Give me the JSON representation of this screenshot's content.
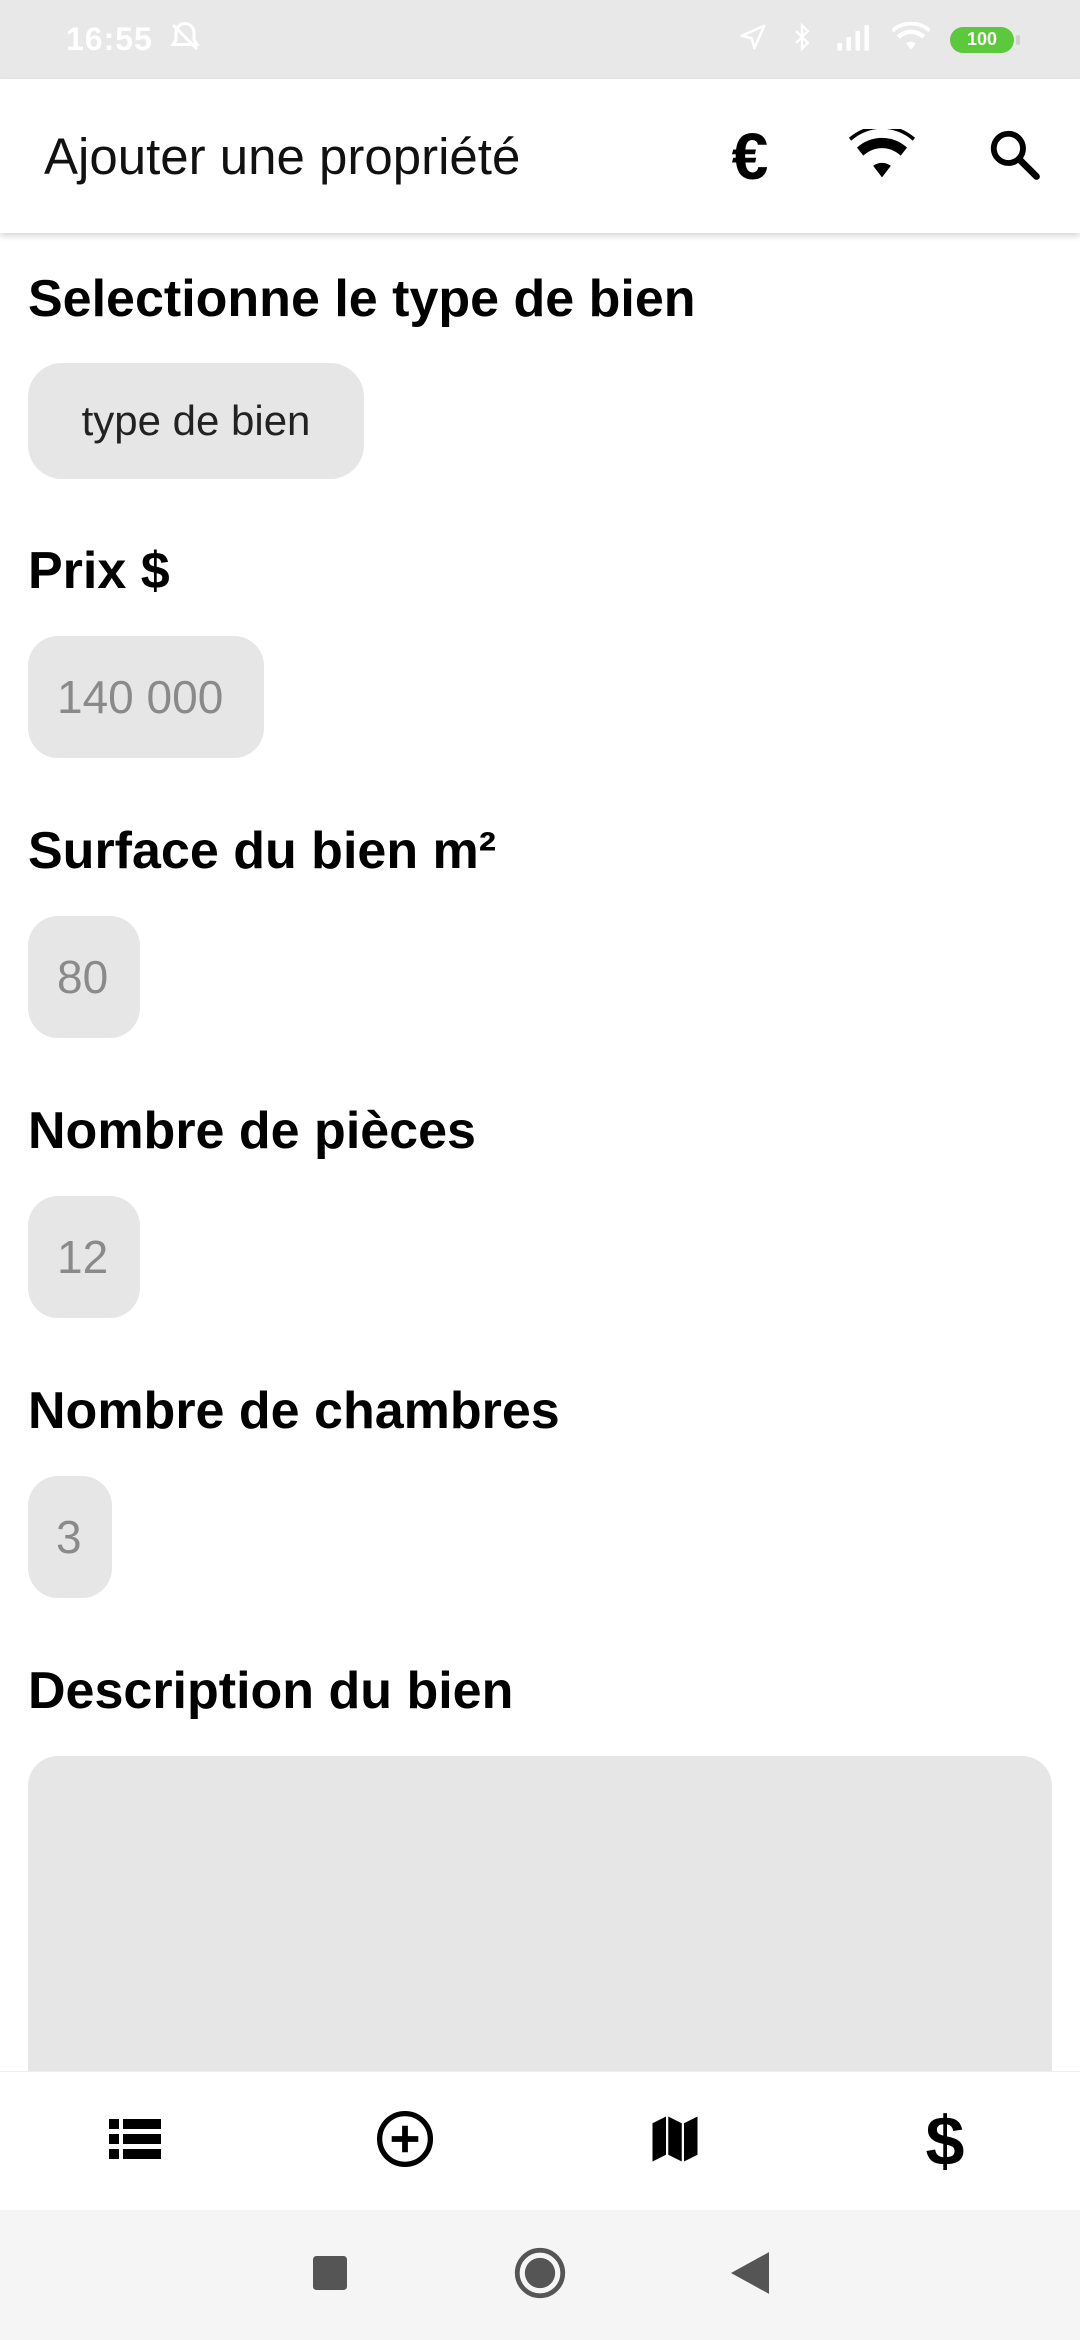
{
  "status_bar": {
    "time": "16:55",
    "battery": "100",
    "icons": [
      "alarm-off-icon",
      "location-icon",
      "bluetooth-icon",
      "signal-icon",
      "wifi-icon",
      "battery-icon"
    ]
  },
  "app_bar": {
    "title": "Ajouter une propriété",
    "actions": [
      {
        "name": "currency-euro",
        "icon": "euro-icon",
        "glyph": "€"
      },
      {
        "name": "wifi",
        "icon": "wifi-icon"
      },
      {
        "name": "search",
        "icon": "search-icon"
      }
    ]
  },
  "form": {
    "type": {
      "label": "Selectionne le type de bien",
      "button_label": "type de bien"
    },
    "price": {
      "label": "Prix $",
      "placeholder": "140 000"
    },
    "surface": {
      "label": "Surface du bien m²",
      "placeholder": "80"
    },
    "rooms": {
      "label": "Nombre de pièces",
      "placeholder": "12"
    },
    "bedrooms": {
      "label": "Nombre de chambres",
      "placeholder": "3"
    },
    "description": {
      "label": "Description du bien",
      "value": ""
    }
  },
  "bottom_nav": {
    "items": [
      {
        "name": "list",
        "icon": "list-icon"
      },
      {
        "name": "add",
        "icon": "add-circle-icon"
      },
      {
        "name": "map",
        "icon": "map-icon"
      },
      {
        "name": "currency",
        "icon": "dollar-icon",
        "glyph": "$"
      }
    ]
  },
  "system_nav": {
    "buttons": [
      "recents-square-icon",
      "home-circle-icon",
      "back-triangle-icon"
    ]
  },
  "colors": {
    "status_bar_bg": "#e8e8e8",
    "field_bg": "#e6e6e6",
    "placeholder_text": "#8a8a8a",
    "battery_green": "#5cc83c"
  }
}
